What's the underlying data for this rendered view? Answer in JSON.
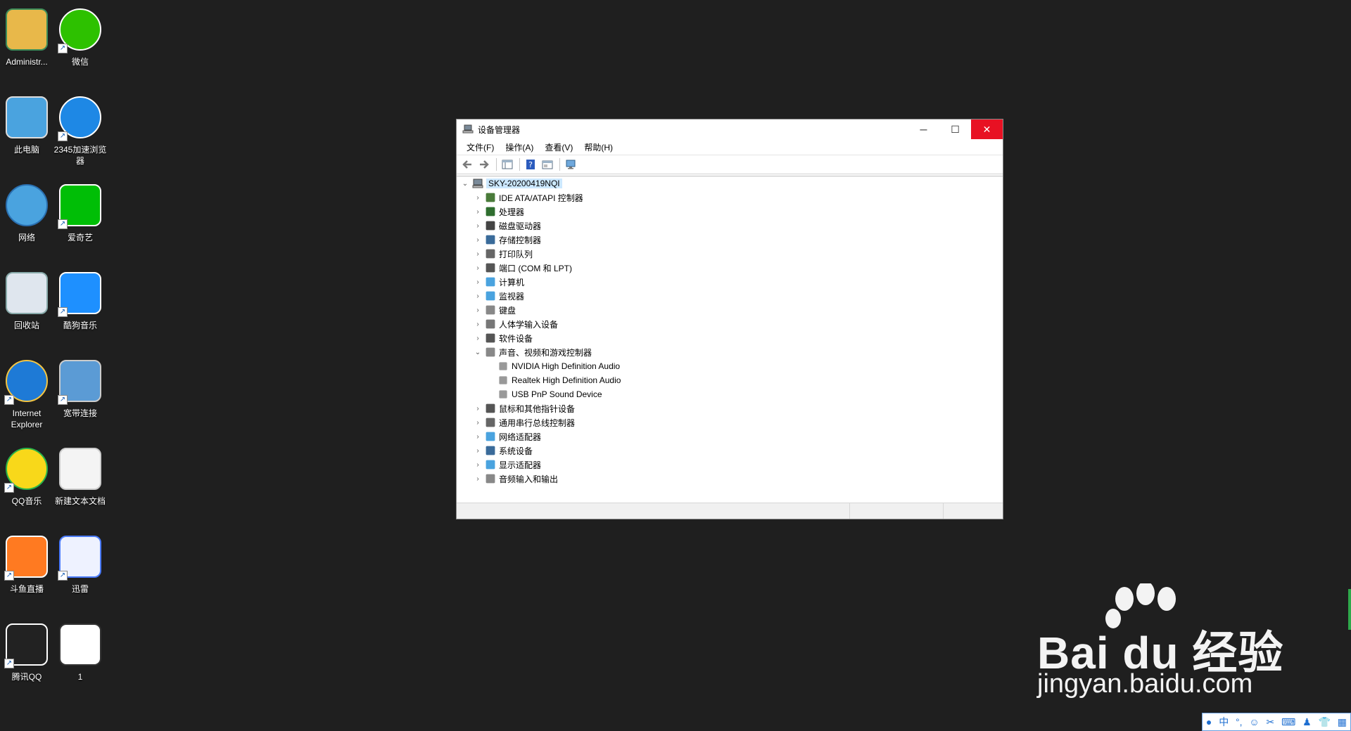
{
  "desktop": {
    "icons": [
      {
        "label": "Administr...",
        "icon": "user-folder-icon"
      },
      {
        "label": "微信",
        "icon": "wechat-icon"
      },
      {
        "label": "此电脑",
        "icon": "this-pc-icon"
      },
      {
        "label": "2345加速浏览器",
        "icon": "browser-2345-icon"
      },
      {
        "label": "网络",
        "icon": "network-icon"
      },
      {
        "label": "爱奇艺",
        "icon": "iqiyi-icon"
      },
      {
        "label": "回收站",
        "icon": "recycle-bin-icon"
      },
      {
        "label": "酷狗音乐",
        "icon": "kugou-icon"
      },
      {
        "label": "Internet Explorer",
        "icon": "ie-icon"
      },
      {
        "label": "宽带连接",
        "icon": "broadband-icon"
      },
      {
        "label": "QQ音乐",
        "icon": "qqmusic-icon"
      },
      {
        "label": "新建文本文档",
        "icon": "text-document-icon"
      },
      {
        "label": "斗鱼直播",
        "icon": "douyu-icon"
      },
      {
        "label": "迅雷",
        "icon": "xunlei-icon"
      },
      {
        "label": "腾讯QQ",
        "icon": "qq-icon"
      },
      {
        "label": "1",
        "icon": "image-file-icon"
      }
    ]
  },
  "window": {
    "title": "设备管理器",
    "menu": [
      "文件(F)",
      "操作(A)",
      "查看(V)",
      "帮助(H)"
    ],
    "root": "SKY-20200419NQI",
    "tree": [
      {
        "label": "IDE ATA/ATAPI 控制器",
        "expanded": false,
        "icon": "ide-controller-icon"
      },
      {
        "label": "处理器",
        "expanded": false,
        "icon": "processor-icon"
      },
      {
        "label": "磁盘驱动器",
        "expanded": false,
        "icon": "disk-drive-icon"
      },
      {
        "label": "存储控制器",
        "expanded": false,
        "icon": "storage-controller-icon"
      },
      {
        "label": "打印队列",
        "expanded": false,
        "icon": "printer-icon"
      },
      {
        "label": "端口 (COM 和 LPT)",
        "expanded": false,
        "icon": "port-icon"
      },
      {
        "label": "计算机",
        "expanded": false,
        "icon": "computer-icon"
      },
      {
        "label": "监视器",
        "expanded": false,
        "icon": "monitor-icon"
      },
      {
        "label": "键盘",
        "expanded": false,
        "icon": "keyboard-icon"
      },
      {
        "label": "人体学输入设备",
        "expanded": false,
        "icon": "hid-icon"
      },
      {
        "label": "软件设备",
        "expanded": false,
        "icon": "software-device-icon"
      },
      {
        "label": "声音、视频和游戏控制器",
        "expanded": true,
        "icon": "speaker-icon",
        "children": [
          "NVIDIA High Definition Audio",
          "Realtek High Definition Audio",
          "USB PnP Sound Device"
        ]
      },
      {
        "label": "鼠标和其他指针设备",
        "expanded": false,
        "icon": "mouse-icon"
      },
      {
        "label": "通用串行总线控制器",
        "expanded": false,
        "icon": "usb-icon"
      },
      {
        "label": "网络适配器",
        "expanded": false,
        "icon": "network-adapter-icon"
      },
      {
        "label": "系统设备",
        "expanded": false,
        "icon": "system-device-icon"
      },
      {
        "label": "显示适配器",
        "expanded": false,
        "icon": "display-adapter-icon"
      },
      {
        "label": "音频输入和输出",
        "expanded": false,
        "icon": "audio-io-icon"
      }
    ]
  },
  "watermark": {
    "main": "Bai du 经验",
    "sub": "jingyan.baidu.com"
  },
  "tray": {
    "ime": "中"
  },
  "colors": {
    "desktop_bg": "#1f1f1f",
    "close_button": "#e81123",
    "selection": "#cce8ff"
  }
}
